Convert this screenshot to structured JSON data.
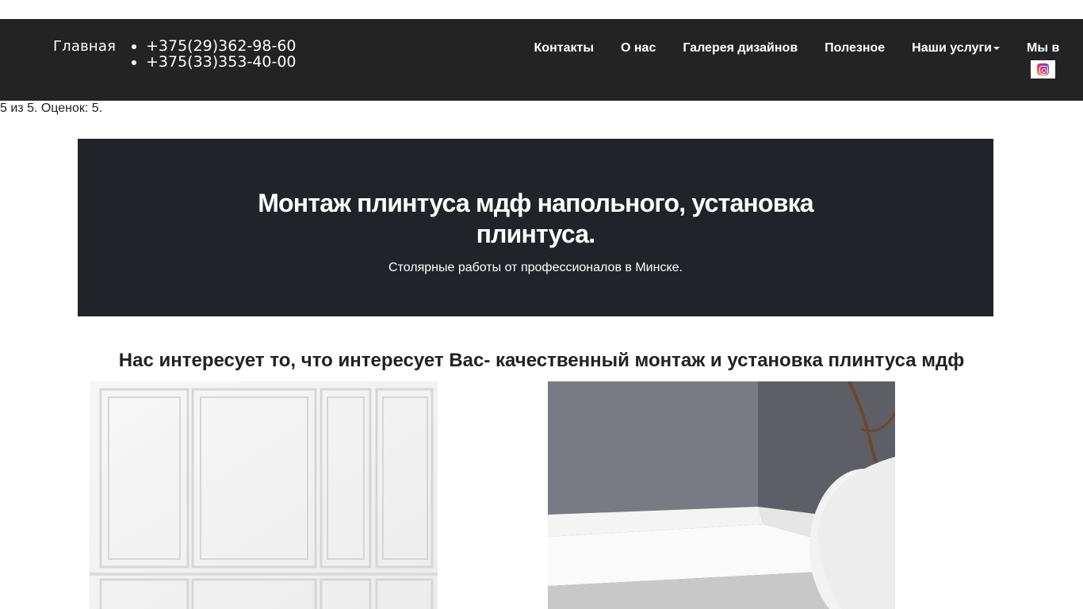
{
  "header": {
    "brand": "Главная",
    "phones": [
      "+375(29)362-98-60",
      "+375(33)353-40-00"
    ],
    "menu": [
      {
        "label": "Контакты"
      },
      {
        "label": "О нас"
      },
      {
        "label": "Галерея дизайнов"
      },
      {
        "label": "Полезное"
      },
      {
        "label": "Наши услуги",
        "dropdown": true
      }
    ],
    "social_label": "Мы в",
    "social_icon": "instagram-icon"
  },
  "rating": "5 из 5. Оценок: 5.",
  "hero": {
    "title": "Монтаж плинтуса мдф напольного, установка плинтуса.",
    "subtitle": "Столярные работы от профессионалов в Минске."
  },
  "section": {
    "title": "Нас интересует то, что интересует Вас- качественный монтаж и установка плинтуса мдф"
  },
  "colors": {
    "navbar": "#232323",
    "hero": "#222328",
    "text": "#222222"
  }
}
